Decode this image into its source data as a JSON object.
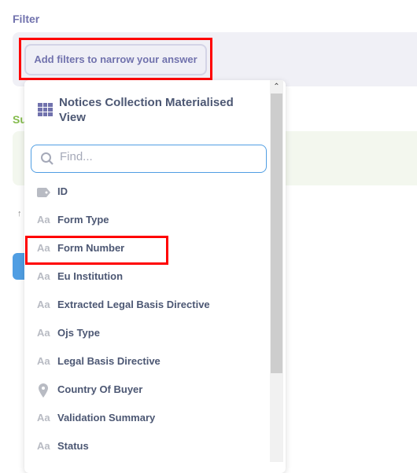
{
  "filter": {
    "label": "Filter",
    "add_button": "Add filters to narrow your answer"
  },
  "summarize": {
    "label_partial": "Su"
  },
  "arrow": "↑",
  "dropdown": {
    "title": "Notices Collection Materialised View",
    "search_placeholder": "Find...",
    "items": [
      {
        "label": "ID",
        "icon": "tag-icon"
      },
      {
        "label": "Form Type",
        "icon": "text-icon"
      },
      {
        "label": "Form Number",
        "icon": "text-icon",
        "highlighted": true
      },
      {
        "label": "Eu Institution",
        "icon": "text-icon"
      },
      {
        "label": "Extracted Legal Basis Directive",
        "icon": "text-icon"
      },
      {
        "label": "Ojs Type",
        "icon": "text-icon"
      },
      {
        "label": "Legal Basis Directive",
        "icon": "text-icon"
      },
      {
        "label": "Country Of Buyer",
        "icon": "location-pin-icon"
      },
      {
        "label": "Validation Summary",
        "icon": "text-icon"
      },
      {
        "label": "Status",
        "icon": "text-icon"
      }
    ],
    "text_icon_glyph": "Aa"
  },
  "colors": {
    "accent": "#7172ad",
    "highlight": "#ff0000",
    "focus": "#509ee3"
  }
}
